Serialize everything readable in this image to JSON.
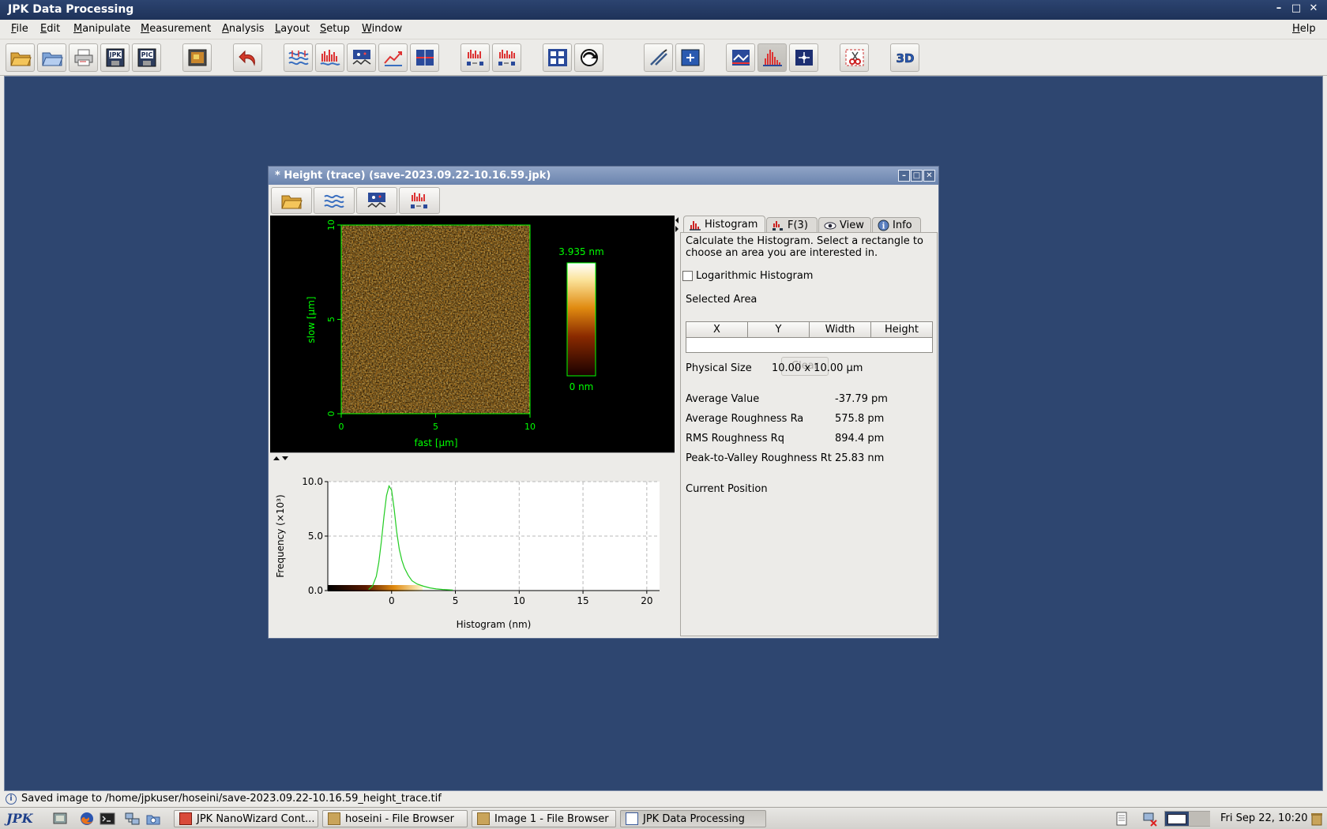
{
  "window": {
    "title": "JPK Data Processing"
  },
  "menu": [
    {
      "label": "File",
      "mnemonic": "F",
      "rest": "ile"
    },
    {
      "label": "Edit",
      "mnemonic": "E",
      "rest": "dit"
    },
    {
      "label": "Manipulate",
      "mnemonic": "M",
      "rest": "anipulate"
    },
    {
      "label": "Measurement",
      "mnemonic": "M",
      "rest": "easurement"
    },
    {
      "label": "Analysis",
      "mnemonic": "A",
      "rest": "nalysis"
    },
    {
      "label": "Layout",
      "mnemonic": "L",
      "rest": "ayout"
    },
    {
      "label": "Setup",
      "mnemonic": "S",
      "rest": "etup"
    },
    {
      "label": "Window",
      "mnemonic": "W",
      "rest": "indow"
    },
    {
      "label": "Help",
      "mnemonic": "H",
      "rest": "elp"
    }
  ],
  "toolbar": {
    "jpk_label": "JPK",
    "pic_label": "PIC",
    "three_d_label": "3D"
  },
  "image_window": {
    "title": "* Height (trace) (save-2023.09.22-10.16.59.jpk)"
  },
  "afm_image": {
    "y_axis_label": "slow [µm]",
    "x_axis_label": "fast [µm]",
    "x_ticks": [
      "0",
      "5",
      "10"
    ],
    "y_ticks": [
      "0",
      "5",
      "10"
    ],
    "colorbar_max": "3.935 nm",
    "colorbar_min": "0 nm",
    "accent_color": "#00ff00"
  },
  "chart_data": {
    "type": "line",
    "xlabel": "Histogram (nm)",
    "ylabel": "Frequency (×10³)",
    "xlim": [
      -5,
      21
    ],
    "ylim": [
      0,
      10
    ],
    "x_ticks": [
      "0",
      "5",
      "10",
      "15",
      "20"
    ],
    "y_ticks": [
      "0.0",
      "5.0",
      "10.0"
    ],
    "grid": true,
    "series": [
      {
        "color": "#22cc22",
        "x": [
          -1.8,
          -1.5,
          -1.2,
          -1.0,
          -0.8,
          -0.6,
          -0.4,
          -0.2,
          0.0,
          0.2,
          0.4,
          0.6,
          0.8,
          1.0,
          1.3,
          1.6,
          2.0,
          2.5,
          3.0,
          3.5,
          4.0,
          4.8
        ],
        "y": [
          0.1,
          0.4,
          1.3,
          2.6,
          4.5,
          6.8,
          8.7,
          9.6,
          9.2,
          7.5,
          5.4,
          3.8,
          2.8,
          2.1,
          1.4,
          0.9,
          0.6,
          0.4,
          0.25,
          0.15,
          0.1,
          0.05
        ]
      }
    ]
  },
  "panel": {
    "tabs": [
      {
        "label": "Histogram",
        "icon": "histogram-icon"
      },
      {
        "label": "F(3)",
        "icon": "function-icon"
      },
      {
        "label": "View",
        "icon": "eye-icon"
      },
      {
        "label": "Info",
        "icon": "info-icon"
      }
    ],
    "description": "Calculate the Histogram. Select a rectangle to choose an area you are interested in.",
    "log_histogram_label": "Logarithmic Histogram",
    "log_histogram_checked": false,
    "selected_area_label": "Selected Area",
    "table_headers": [
      "X",
      "Y",
      "Width",
      "Height"
    ],
    "clear_label": "Clear",
    "physical_size_label": "Physical Size",
    "physical_size_value": "10.00 x 10.00 µm",
    "stats": [
      {
        "label": "Average Value",
        "value": "-37.79 pm"
      },
      {
        "label": "Average Roughness Ra",
        "value": "575.8 pm"
      },
      {
        "label": "RMS Roughness Rq",
        "value": "894.4 pm"
      },
      {
        "label": "Peak-to-Valley Roughness Rt",
        "value": "25.83 nm"
      }
    ],
    "current_position_label": "Current Position"
  },
  "status": {
    "message": "Saved image to /home/jpkuser/hoseini/save-2023.09.22-10.16.59_height_trace.tif"
  },
  "taskbar": {
    "logo": "JPK",
    "tasks": [
      {
        "label": "JPK NanoWizard Cont...",
        "active": false
      },
      {
        "label": "hoseini - File Browser",
        "active": false
      },
      {
        "label": "Image 1 - File Browser",
        "active": false
      },
      {
        "label": "JPK Data Processing",
        "active": true
      }
    ],
    "clock": "Fri Sep 22, 10:20"
  }
}
